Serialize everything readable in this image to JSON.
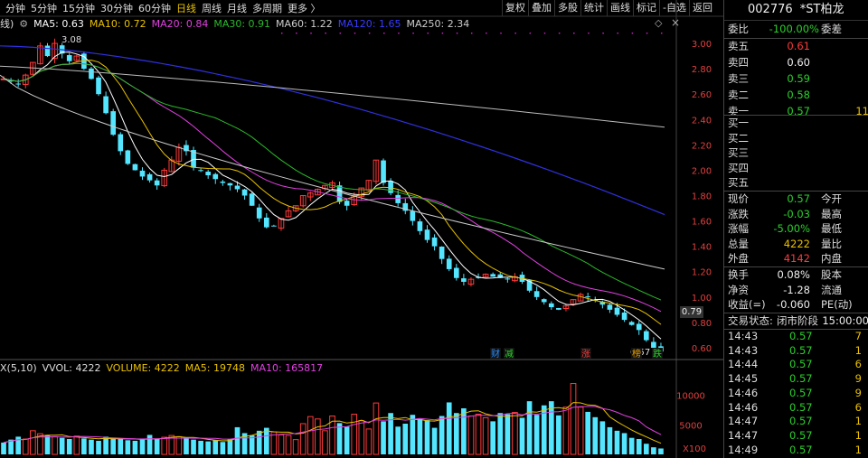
{
  "periods": [
    "分钟",
    "5分钟",
    "15分钟",
    "30分钟",
    "60分钟",
    "日线",
    "周线",
    "月线",
    "多周期",
    "更多 〉"
  ],
  "active_period": "日线",
  "toolbar": [
    "复权",
    "叠加",
    "多股",
    "统计",
    "画线",
    "标记",
    "-自选",
    "返回"
  ],
  "ma": {
    "prefix": "线)",
    "ma5": "MA5: 0.63",
    "ma10": "MA10: 0.72",
    "ma20": "MA20: 0.84",
    "ma30": "MA30: 0.91",
    "ma60": "MA60: 1.22",
    "ma120": "MA120: 1.65",
    "ma250": "MA250: 2.34",
    "colors": {
      "ma5": "#ffffff",
      "ma10": "#e8c000",
      "ma20": "#e040e0",
      "ma30": "#2bb82b",
      "ma60": "#cccccc",
      "ma120": "#3030e0",
      "ma250": "#bbbbbb"
    }
  },
  "vol_legend": {
    "prefix": "X(5,10)",
    "vvol": "VVOL: 4222",
    "volume": "VOLUME: 4222",
    "ma5": "MA5: 19748",
    "ma10": "MA10: 165817"
  },
  "chart_data": {
    "type": "candlestick",
    "y_ticks": [
      "3.00",
      "2.80",
      "2.60",
      "2.40",
      "2.20",
      "2.00",
      "1.80",
      "1.60",
      "1.40",
      "1.20",
      "1.00",
      "0.80",
      "0.60"
    ],
    "ylim": [
      0.55,
      3.1
    ],
    "high_label": "3.08",
    "low_label": "0.57",
    "last_price": "0.79",
    "vol_ticks": [
      "10000",
      "5000"
    ],
    "vol_unit": "X100",
    "markers": [
      {
        "text": "财",
        "color": "#2a8cff"
      },
      {
        "text": "减",
        "color": "#2bd12b"
      },
      {
        "text": "涨",
        "color": "#ff3a3a"
      },
      {
        "text": "榜",
        "color": "#e8a000"
      },
      {
        "text": "跌",
        "color": "#2bd12b"
      }
    ],
    "close": [
      2.72,
      2.7,
      2.68,
      2.75,
      2.85,
      2.98,
      2.9,
      3.0,
      2.92,
      2.86,
      2.9,
      2.8,
      2.72,
      2.6,
      2.45,
      2.28,
      2.15,
      2.05,
      2.0,
      1.95,
      1.92,
      1.88,
      2.0,
      2.08,
      2.18,
      2.15,
      2.02,
      2.0,
      1.96,
      1.93,
      1.9,
      1.88,
      1.85,
      1.8,
      1.72,
      1.62,
      1.55,
      1.56,
      1.62,
      1.68,
      1.72,
      1.8,
      1.82,
      1.85,
      1.88,
      1.9,
      1.75,
      1.72,
      1.8,
      1.86,
      1.92,
      2.08,
      1.9,
      1.82,
      1.74,
      1.68,
      1.6,
      1.52,
      1.45,
      1.4,
      1.3,
      1.22,
      1.15,
      1.12,
      1.14,
      1.15,
      1.18,
      1.16,
      1.15,
      1.14,
      1.16,
      1.12,
      1.05,
      1.0,
      0.96,
      0.92,
      0.9,
      0.93,
      0.98,
      1.02,
      1.0,
      0.97,
      0.94,
      0.9,
      0.86,
      0.82,
      0.78,
      0.74,
      0.66,
      0.6,
      0.57
    ],
    "volume": [
      2000,
      2500,
      3000,
      2600,
      4000,
      3500,
      3200,
      3000,
      2800,
      2600,
      3100,
      2700,
      2500,
      2300,
      3000,
      2800,
      2600,
      2400,
      2300,
      2500,
      3300,
      2600,
      2900,
      3200,
      3000,
      2700,
      2500,
      2300,
      2200,
      2400,
      2100,
      2600,
      4600,
      3600,
      3200,
      4000,
      4500,
      3800,
      3300,
      3200,
      2500,
      5200,
      6400,
      6000,
      4000,
      6500,
      5300,
      4700,
      6800,
      5700,
      4300,
      8700,
      5600,
      7000,
      4700,
      5200,
      6700,
      6000,
      5800,
      4500,
      6500,
      8800,
      7000,
      7800,
      6500,
      6800,
      6200,
      5600,
      7000,
      6800,
      7100,
      6200,
      9000,
      6700,
      8300,
      9000,
      6600,
      8000,
      12000,
      8000,
      7200,
      6300,
      5600,
      4600,
      4000,
      3600,
      2800,
      2600,
      1800,
      1200,
      1000
    ]
  },
  "quote": {
    "code": "002776",
    "name": "*ST柏龙",
    "weibi_label": "委比",
    "weibi": "-100.00%",
    "weicha_label": "委差",
    "asks": [
      {
        "label": "卖五",
        "price": "0.61"
      },
      {
        "label": "卖四",
        "price": "0.60"
      },
      {
        "label": "卖三",
        "price": "0.59"
      },
      {
        "label": "卖二",
        "price": "0.58"
      },
      {
        "label": "卖一",
        "price": "0.57",
        "vol": "11"
      }
    ],
    "bids": [
      {
        "label": "买一"
      },
      {
        "label": "买二"
      },
      {
        "label": "买三"
      },
      {
        "label": "买四"
      },
      {
        "label": "买五"
      }
    ],
    "stats": [
      {
        "l": "现价",
        "v": "0.57",
        "vc": "green",
        "l2": "今开"
      },
      {
        "l": "涨跌",
        "v": "-0.03",
        "vc": "green",
        "l2": "最高"
      },
      {
        "l": "涨幅",
        "v": "-5.00%",
        "vc": "green",
        "l2": "最低"
      },
      {
        "l": "总量",
        "v": "4222",
        "vc": "yellow",
        "l2": "量比"
      },
      {
        "l": "外盘",
        "v": "4142",
        "vc": "red",
        "l2": "内盘"
      }
    ],
    "stats2": [
      {
        "l": "换手",
        "v": "0.08%",
        "vc": "white",
        "l2": "股本"
      },
      {
        "l": "净资",
        "v": "-1.28",
        "vc": "white",
        "l2": "流通"
      },
      {
        "l": "收益(=)",
        "v": "-0.060",
        "vc": "white",
        "l2": "PE(动)"
      }
    ],
    "status_label": "交易状态:",
    "status": "闭市阶段",
    "status_time": "15:00:00",
    "ticks": [
      {
        "t": "14:43",
        "p": "0.57",
        "q": "7"
      },
      {
        "t": "14:43",
        "p": "0.57",
        "q": "1"
      },
      {
        "t": "14:44",
        "p": "0.57",
        "q": "6"
      },
      {
        "t": "14:45",
        "p": "0.57",
        "q": "9"
      },
      {
        "t": "14:46",
        "p": "0.57",
        "q": "9"
      },
      {
        "t": "14:46",
        "p": "0.57",
        "q": "6"
      },
      {
        "t": "14:47",
        "p": "0.57",
        "q": "1"
      },
      {
        "t": "14:47",
        "p": "0.57",
        "q": "1"
      },
      {
        "t": "14:49",
        "p": "0.57",
        "q": "1"
      }
    ]
  }
}
